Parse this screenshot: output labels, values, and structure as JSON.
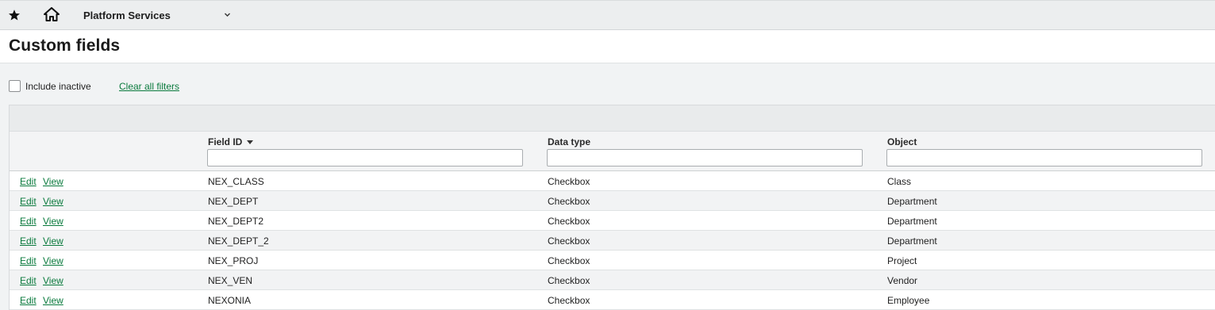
{
  "header": {
    "app_name": "Platform Services",
    "icons": [
      "star-icon",
      "home-icon",
      "chevron-down-icon"
    ]
  },
  "page": {
    "title": "Custom fields"
  },
  "filters": {
    "include_inactive_label": "Include inactive",
    "include_inactive_checked": false,
    "clear_all_label": "Clear all filters"
  },
  "table": {
    "columns": [
      {
        "label": "Field ID",
        "sorted": "descending"
      },
      {
        "label": "Data type"
      },
      {
        "label": "Object"
      }
    ],
    "action_labels": {
      "edit": "Edit",
      "view": "View"
    },
    "rows": [
      {
        "field_id": "NEX_CLASS",
        "data_type": "Checkbox",
        "object": "Class"
      },
      {
        "field_id": "NEX_DEPT",
        "data_type": "Checkbox",
        "object": "Department"
      },
      {
        "field_id": "NEX_DEPT2",
        "data_type": "Checkbox",
        "object": "Department"
      },
      {
        "field_id": "NEX_DEPT_2",
        "data_type": "Checkbox",
        "object": "Department"
      },
      {
        "field_id": "NEX_PROJ",
        "data_type": "Checkbox",
        "object": "Project"
      },
      {
        "field_id": "NEX_VEN",
        "data_type": "Checkbox",
        "object": "Vendor"
      },
      {
        "field_id": "NEXONIA",
        "data_type": "Checkbox",
        "object": "Employee"
      }
    ]
  },
  "colors": {
    "link": "#0a7a3d",
    "topbar_bg": "#eceeef",
    "alt_row_bg": "#f2f3f4"
  }
}
